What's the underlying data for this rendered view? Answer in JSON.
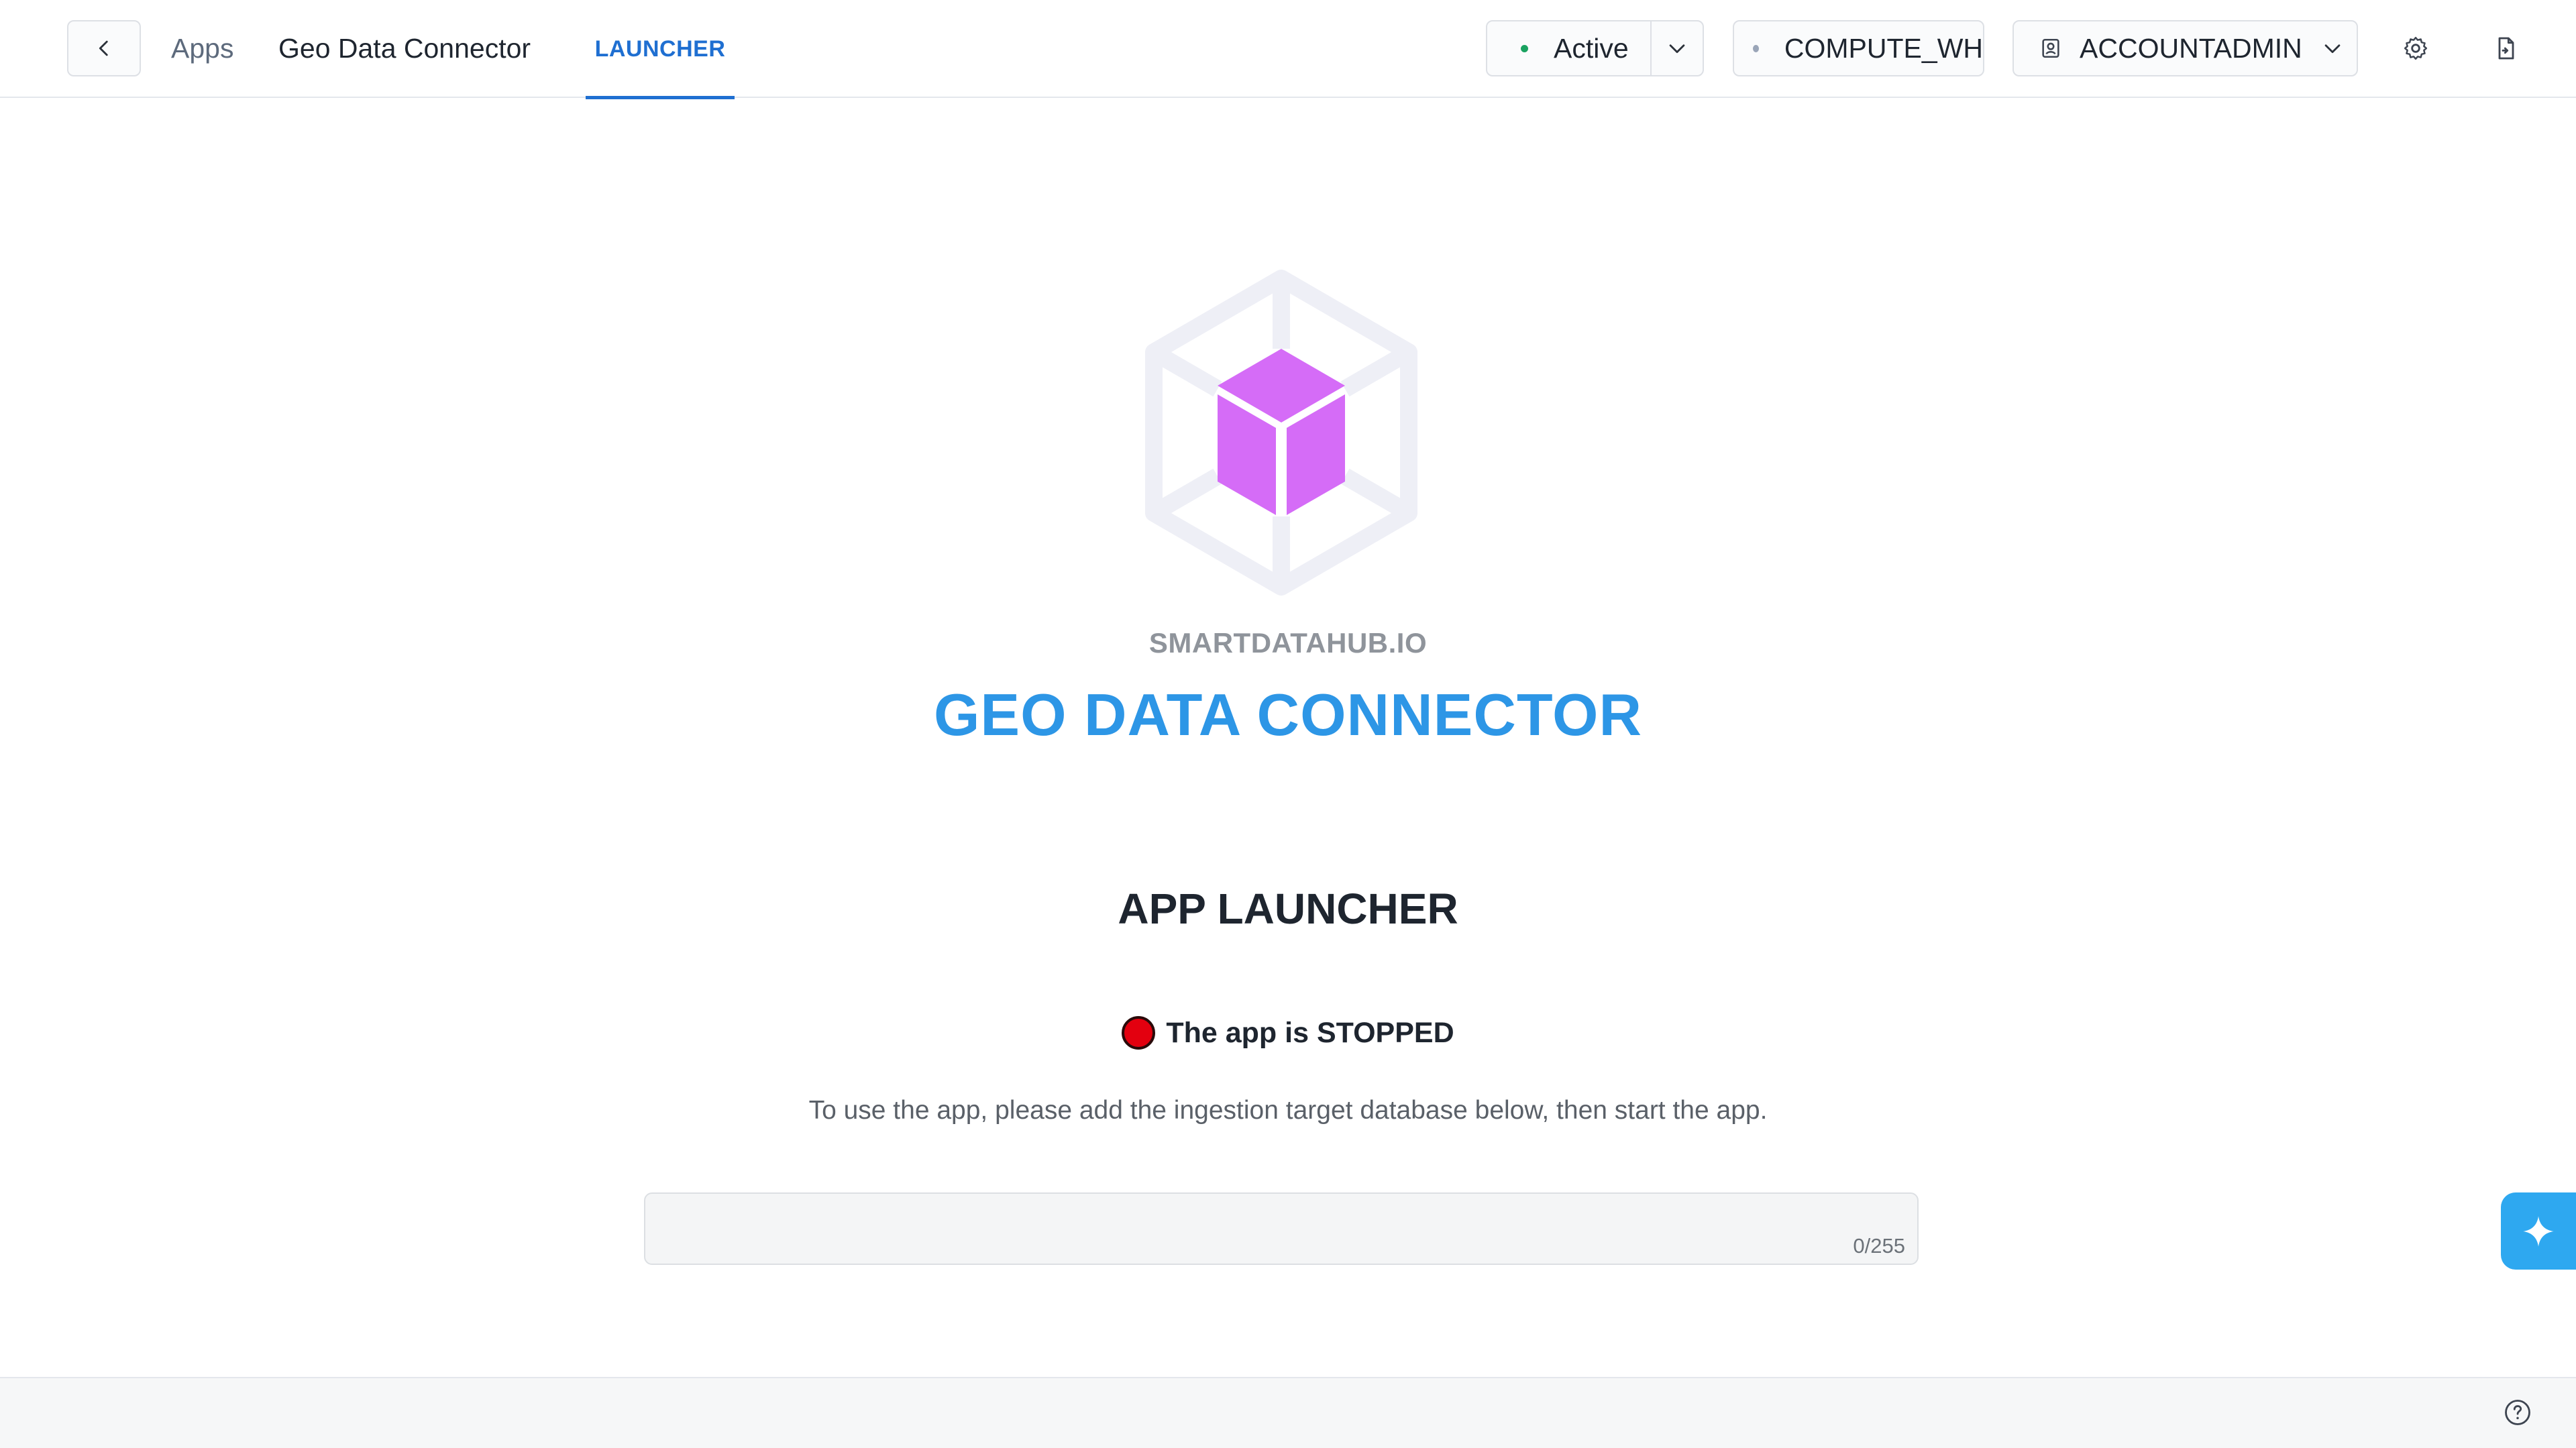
{
  "header": {
    "breadcrumb_apps": "Apps",
    "app_name": "Geo Data Connector",
    "tabs": [
      {
        "label": "LAUNCHER",
        "active": true
      }
    ],
    "status": {
      "label": "Active",
      "dot_color": "#1aa260"
    },
    "warehouse": {
      "label": "COMPUTE_WH",
      "dot_color": "#9aa5b8"
    },
    "role": {
      "label": "ACCOUNTADMIN"
    },
    "icons": [
      "chevron-left-icon",
      "chevron-down-icon",
      "user-badge-icon",
      "gear-icon",
      "document-export-icon"
    ]
  },
  "main": {
    "logo": {
      "alt": "cube-logo",
      "cube_color": "#d56cf7"
    },
    "vendor": "SMARTDATAHUB.IO",
    "title": "GEO DATA CONNECTOR",
    "section_heading": "APP LAUNCHER",
    "status": {
      "text": "The app is STOPPED",
      "color": "#e3000f"
    },
    "instructions": "To use the app, please add the ingestion target database below, then start the app.",
    "database_input": {
      "value": "",
      "placeholder": "",
      "counter": "0/255"
    }
  },
  "assistant": {
    "icon": "sparkle-icon",
    "color": "#2ea8f0"
  },
  "footer": {
    "icon": "help-icon"
  }
}
